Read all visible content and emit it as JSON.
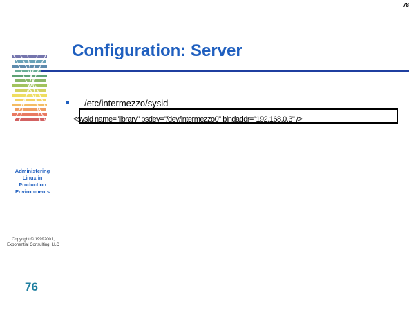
{
  "header": {
    "corner_page_number": "78"
  },
  "slide": {
    "title": "Configuration: Server",
    "bullet": "/etc/intermezzo/sysid",
    "code": "<sysid name=\"library\" psdev=\"/dev/intermezzo0\" bindaddr=\"192.168.0.3\" />"
  },
  "sidebar": {
    "caption_lines": [
      "Administering",
      "Linux in",
      "Production",
      "Environments"
    ],
    "copyright_lines": [
      "Copyright © 19992001,",
      "Exponential Consulting, LLC"
    ]
  },
  "footer": {
    "slide_number": "76"
  },
  "colors": {
    "title": "#1f5fbf",
    "rule": "#1f3fa0",
    "slide_number": "#1f7fa0"
  }
}
